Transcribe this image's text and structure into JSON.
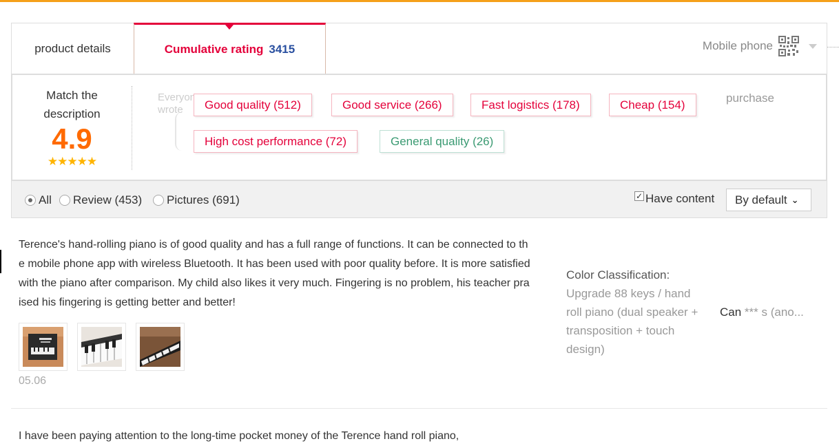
{
  "tabs": {
    "details_label": "product details",
    "rating_label": "Cumulative rating",
    "rating_count": "3415",
    "mobile_label": "Mobile phone"
  },
  "summary": {
    "score_label_line1": "Match the",
    "score_label_line2": "description",
    "score": "4.9",
    "stars": "★★★★★",
    "stars_value": 5,
    "everyone_wrote": "Everyone wrote",
    "purchase": "purchase",
    "tags": [
      {
        "label": "Good quality (512)",
        "tone": "positive"
      },
      {
        "label": "Good service (266)",
        "tone": "positive"
      },
      {
        "label": "Fast logistics (178)",
        "tone": "positive"
      },
      {
        "label": "Cheap (154)",
        "tone": "positive"
      },
      {
        "label": "High cost performance (72)",
        "tone": "positive"
      },
      {
        "label": "General quality (26)",
        "tone": "neutral"
      }
    ]
  },
  "filters": {
    "all": "All",
    "review": "Review (453)",
    "pictures": "Pictures (691)",
    "have_content": "Have content",
    "sort": "By default"
  },
  "reviews": [
    {
      "text": "Terence's hand-rolling piano is of good quality and has a full range of functions. It can be connected to the mobile phone app with wireless Bluetooth. It has been used with poor quality before. It is more satisfied with the piano after comparison. My child also likes it very much. Fingering is no problem, his teacher praised his fingering is getting better and better!",
      "date": "05.06",
      "sku_label": "Color Classification:",
      "sku_value": "Upgrade 88 keys / hand roll piano (dual speaker + transposition + touch design)",
      "user_start": "Can",
      "user_masked": "*** s (ano..."
    },
    {
      "text": "I have been paying attention to the long-time pocket money of the Terence hand roll piano,"
    }
  ],
  "colors": {
    "accent_red": "#e4003a",
    "count_blue": "#2a50a0",
    "score_orange": "#ff6a00",
    "top_bar": "#f5a01a"
  }
}
